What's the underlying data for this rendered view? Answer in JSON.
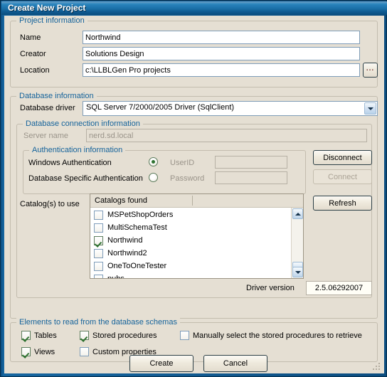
{
  "window": {
    "title": "Create New Project",
    "accent_titlebar": "#1a6ea6",
    "dialog_bg": "#e5dfd3",
    "group_label_color": "#15639b"
  },
  "project_information": {
    "legend": "Project information",
    "fields": [
      {
        "label": "Name",
        "value": "Northwind"
      },
      {
        "label": "Creator",
        "value": "Solutions Design"
      },
      {
        "label": "Location",
        "value": "c:\\LLBLGen Pro projects"
      }
    ],
    "browse_button": "..."
  },
  "database_information": {
    "legend": "Database information",
    "driver_label": "Database driver",
    "driver_value": "SQL Server 7/2000/2005 Driver (SqlClient)",
    "connection": {
      "legend": "Database connection information",
      "server_label": "Server name",
      "server_value": "nerd.sd.local",
      "server_enabled": false
    },
    "authentication": {
      "legend": "Authentication information",
      "windows_label": "Windows Authentication",
      "dbspecific_label": "Database Specific Authentication",
      "selected": "windows",
      "userid_label": "UserID",
      "userid_value": "",
      "password_label": "Password",
      "password_value": ""
    },
    "buttons": {
      "disconnect": "Disconnect",
      "connect": "Connect",
      "connect_enabled": false,
      "refresh": "Refresh"
    },
    "catalogs": {
      "label": "Catalog(s) to use",
      "column_header": "Catalogs found",
      "items": [
        {
          "name": "MSPetShopOrders",
          "checked": false
        },
        {
          "name": "MultiSchemaTest",
          "checked": false
        },
        {
          "name": "Northwind",
          "checked": true
        },
        {
          "name": "Northwind2",
          "checked": false
        },
        {
          "name": "OneToOneTester",
          "checked": false
        },
        {
          "name": "pubs",
          "checked": false
        }
      ]
    },
    "driver_version_label": "Driver version",
    "driver_version_value": "2.5.06292007"
  },
  "elements_group": {
    "legend": "Elements to read from the database schemas",
    "options": [
      {
        "label": "Tables",
        "checked": true
      },
      {
        "label": "Views",
        "checked": true
      },
      {
        "label": "Stored procedures",
        "checked": true
      },
      {
        "label": "Custom properties",
        "checked": false
      },
      {
        "label": "Manually select the stored procedures to retrieve",
        "checked": false
      }
    ]
  },
  "footer": {
    "create": "Create",
    "cancel": "Cancel"
  }
}
